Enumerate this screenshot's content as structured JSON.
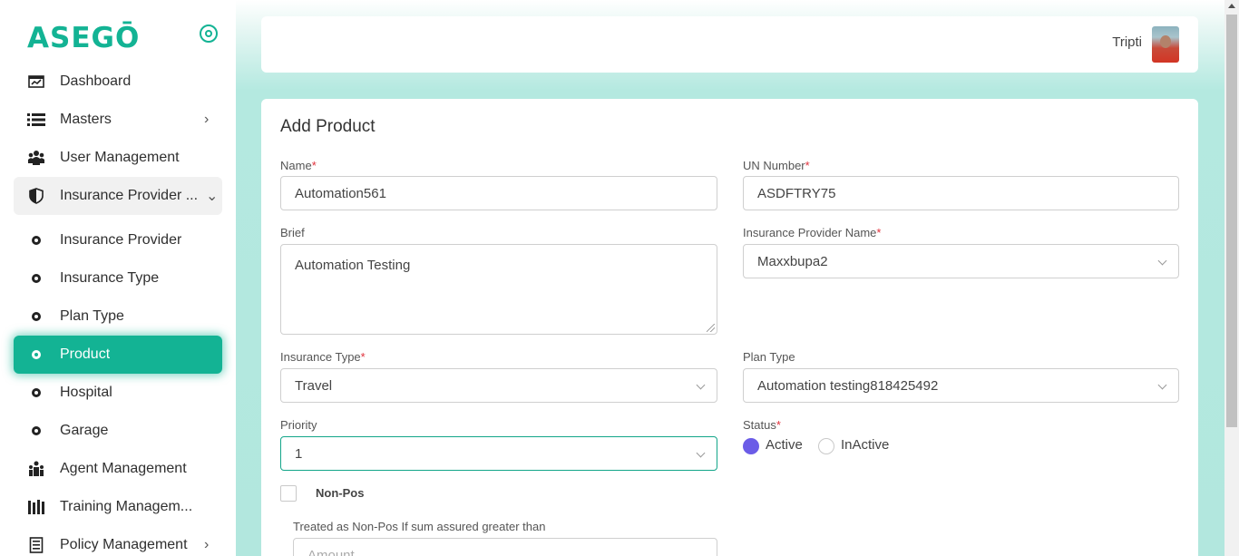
{
  "app": {
    "logo_text": "ASEGŌ"
  },
  "sidebar": {
    "items": [
      {
        "label": "Dashboard",
        "icon": "dashboard-icon"
      },
      {
        "label": "Masters",
        "icon": "list-icon",
        "chevron": "›"
      },
      {
        "label": "User Management",
        "icon": "users-icon"
      },
      {
        "label": "Insurance Provider ...",
        "icon": "shield-icon",
        "chevron": "⌄"
      },
      {
        "label": "Insurance Provider",
        "icon": "dot-icon"
      },
      {
        "label": "Insurance Type",
        "icon": "dot-icon"
      },
      {
        "label": "Plan Type",
        "icon": "dot-icon"
      },
      {
        "label": "Product",
        "icon": "dot-icon"
      },
      {
        "label": "Hospital",
        "icon": "dot-icon"
      },
      {
        "label": "Garage",
        "icon": "dot-icon"
      },
      {
        "label": "Agent Management",
        "icon": "agent-icon"
      },
      {
        "label": "Training Managem...",
        "icon": "books-icon"
      },
      {
        "label": "Policy Management",
        "icon": "document-icon",
        "chevron": "›"
      }
    ]
  },
  "header": {
    "user_name": "Tripti"
  },
  "form": {
    "title": "Add Product",
    "name": {
      "label": "Name",
      "required": "*",
      "value": "Automation561"
    },
    "un_number": {
      "label": "UN Number",
      "required": "*",
      "value": "ASDFTRY75"
    },
    "brief": {
      "label": "Brief",
      "value": "Automation Testing"
    },
    "insurance_provider_name": {
      "label": "Insurance Provider Name",
      "required": "*",
      "value": "Maxxbupa2"
    },
    "insurance_type": {
      "label": "Insurance Type",
      "required": "*",
      "value": "Travel"
    },
    "plan_type": {
      "label": "Plan Type",
      "value": "Automation testing818425492"
    },
    "priority": {
      "label": "Priority",
      "value": "1"
    },
    "status": {
      "label": "Status",
      "required": "*",
      "options": [
        "Active",
        "InActive"
      ],
      "selected": "Active"
    },
    "non_pos": {
      "label": "Non-Pos",
      "checked": false
    },
    "non_pos_threshold": {
      "label": "Treated as Non-Pos If sum assured greater than",
      "placeholder": "Amount"
    }
  },
  "colors": {
    "accent": "#13b394",
    "radio_selected": "#6b5ce7",
    "required": "#e0303b"
  }
}
